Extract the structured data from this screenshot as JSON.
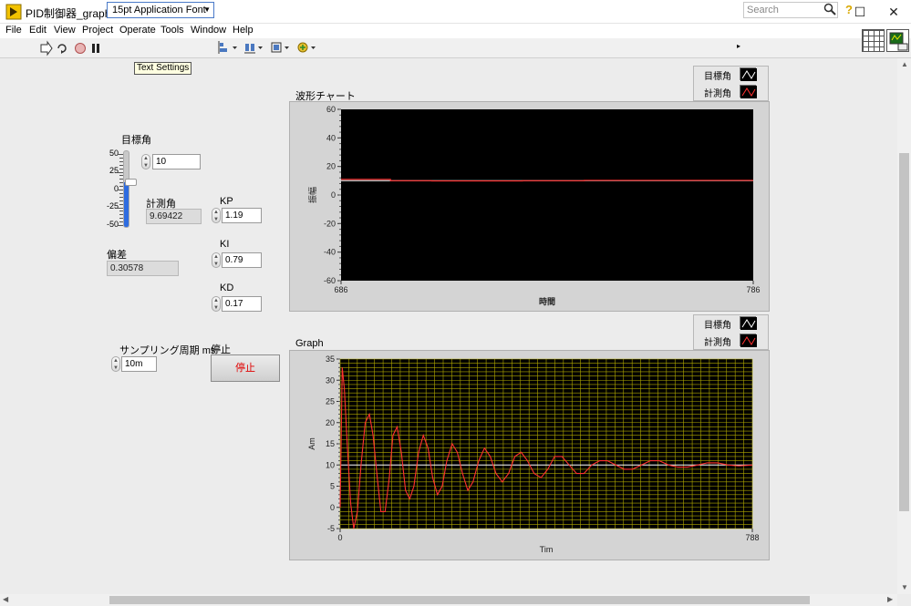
{
  "window": {
    "title": "PID制御器_graph.vi Front Panel",
    "minimize_glyph": "—",
    "maximize_glyph": "☐",
    "close_glyph": "✕"
  },
  "menu": [
    "File",
    "Edit",
    "View",
    "Project",
    "Operate",
    "Tools",
    "Window",
    "Help"
  ],
  "toolbar": {
    "font_select": "15pt Application Font",
    "search_placeholder": "Search",
    "tooltip": "Text Settings",
    "icons": [
      "run-arrow-icon",
      "run-continuous-icon",
      "abort-icon",
      "pause-icon",
      "align-icon",
      "distribute-icon",
      "resize-icon",
      "reorder-icon",
      "search-icon",
      "help-icon"
    ]
  },
  "controls": {
    "target_label": "目標角",
    "target_value": "10",
    "slider_scale": [
      "50",
      "25",
      "0",
      "-25",
      "-50"
    ],
    "slider_level": 10,
    "measured_label": "計測角",
    "measured_value": "9.69422",
    "error_label": "偏差",
    "error_value": "0.30578",
    "kp_label": "KP",
    "kp_value": "1.19",
    "ki_label": "KI",
    "ki_value": "0.79",
    "kd_label": "KD",
    "kd_value": "0.17",
    "sampling_label": "サンプリング周期 ms",
    "sampling_value": "10m",
    "stop_label": "停止",
    "stop_button": "停止"
  },
  "colors": {
    "target_line": "#ffffff",
    "measured_line": "#ff3030",
    "chart1_plot_bg": "#000000",
    "chart2_plot_bg": "#000000",
    "chart2_grid": "#b0a800",
    "stop_text": "#e00000"
  },
  "chart_data": [
    {
      "type": "line",
      "title": "波形チャート",
      "xlabel": "時間",
      "ylabel": "振幅",
      "xlim": [
        686,
        786
      ],
      "ylim": [
        -60,
        60
      ],
      "yticks": [
        "60",
        "40",
        "20",
        "0",
        "-20",
        "-40",
        "-60"
      ],
      "xticks": [
        "686",
        "786"
      ],
      "grid": false,
      "legend_position": "top-right",
      "series": [
        {
          "name": "目標角",
          "x": [
            686,
            786
          ],
          "y": [
            10,
            10
          ]
        },
        {
          "name": "計測角",
          "x": [
            686,
            698,
            698,
            708,
            708,
            730,
            730,
            745,
            745,
            786
          ],
          "y": [
            11,
            11,
            10,
            10,
            9.8,
            9.8,
            10,
            10,
            10.3,
            10.3
          ]
        }
      ]
    },
    {
      "type": "line",
      "title": "Graph",
      "xlabel": "Tim",
      "ylabel": "Am",
      "xlim": [
        0,
        788
      ],
      "ylim": [
        -5,
        35
      ],
      "yticks": [
        "35",
        "30",
        "25",
        "20",
        "15",
        "10",
        "5",
        "0",
        "-5"
      ],
      "xticks": [
        "0",
        "788"
      ],
      "grid": true,
      "legend_position": "top-right",
      "series": [
        {
          "name": "目標角",
          "x": [
            0,
            788
          ],
          "y": [
            10,
            10
          ]
        },
        {
          "name": "計測角",
          "x": [
            0,
            4,
            8,
            14,
            20,
            26,
            33,
            40,
            48,
            56,
            63,
            71,
            78,
            86,
            94,
            101,
            109,
            117,
            125,
            133,
            141,
            150,
            159,
            168,
            177,
            186,
            195,
            204,
            214,
            224,
            234,
            244,
            254,
            265,
            276,
            287,
            298,
            310,
            322,
            334,
            346,
            358,
            371,
            384,
            397,
            410,
            424,
            438,
            452,
            466,
            481,
            496,
            511,
            527,
            543,
            559,
            576,
            593,
            610,
            628,
            646,
            664,
            683,
            702,
            722,
            742,
            762,
            788
          ],
          "y": [
            0,
            33,
            28,
            14,
            1,
            -5,
            -1,
            10,
            20,
            22,
            17,
            7,
            -1,
            -1,
            7,
            17,
            19,
            13,
            4,
            2,
            5,
            13,
            17,
            14,
            7,
            3,
            5,
            11,
            15,
            13,
            8,
            4,
            6,
            11,
            14,
            12,
            8,
            6,
            8,
            12,
            13,
            11,
            8,
            7,
            9,
            12,
            12,
            10,
            8,
            8,
            10,
            11,
            11,
            10,
            9,
            9,
            10,
            11,
            11,
            10,
            9.5,
            9.5,
            10,
            10.5,
            10.5,
            10,
            9.8,
            10
          ]
        }
      ]
    }
  ]
}
